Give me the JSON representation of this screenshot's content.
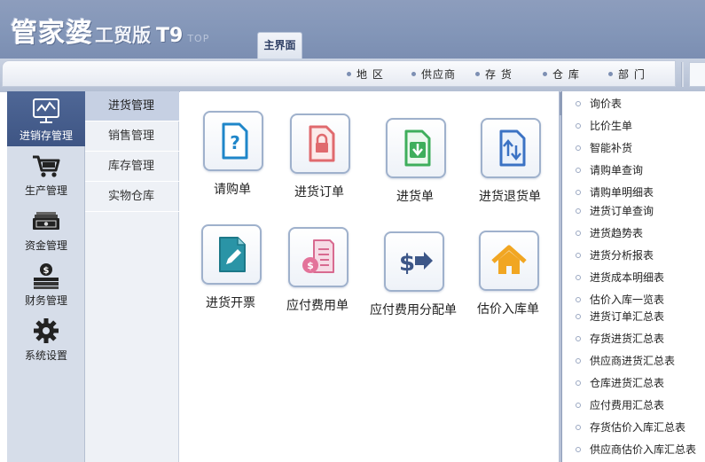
{
  "header": {
    "brand_main": "管家婆",
    "brand_sub": "工贸版",
    "brand_version": "T9",
    "brand_tag": "TOP",
    "main_tab": "主界面"
  },
  "topnav": {
    "items": [
      {
        "label": "地 区",
        "icon": "dot-bullet"
      },
      {
        "label": "供应商",
        "icon": "dot-bullet"
      },
      {
        "label": "存 货",
        "icon": "dot-bullet"
      },
      {
        "label": "仓 库",
        "icon": "dot-bullet"
      },
      {
        "label": "部 门",
        "icon": "dot-bullet"
      }
    ]
  },
  "sidebar": {
    "modules": [
      {
        "label": "进销存管理",
        "icon": "monitor-chart-icon",
        "active": true
      },
      {
        "label": "生产管理",
        "icon": "cart-icon",
        "active": false
      },
      {
        "label": "资金管理",
        "icon": "money-icon",
        "active": false
      },
      {
        "label": "财务管理",
        "icon": "coins-icon",
        "active": false
      },
      {
        "label": "系统设置",
        "icon": "gear-icon",
        "active": false
      }
    ]
  },
  "submenu": {
    "items": [
      {
        "label": "进货管理",
        "active": true
      },
      {
        "label": "销售管理",
        "active": false
      },
      {
        "label": "库存管理",
        "active": false
      },
      {
        "label": "实物仓库",
        "active": false
      }
    ]
  },
  "tiles": [
    {
      "label": "请购单",
      "icon": "question-document-icon"
    },
    {
      "label": "进货订单",
      "icon": "lock-document-icon"
    },
    {
      "label": "进货单",
      "icon": "download-document-icon"
    },
    {
      "label": "进货退货单",
      "icon": "return-document-icon"
    },
    {
      "label": "进货开票",
      "icon": "pencil-document-icon"
    },
    {
      "label": "应付费用单",
      "icon": "coin-document-icon"
    },
    {
      "label": "应付费用分配单",
      "icon": "dollar-arrow-icon"
    },
    {
      "label": "估价入库单",
      "icon": "house-icon"
    }
  ],
  "reports": {
    "items": [
      "询价表",
      "比价生单",
      "智能补货",
      "请购单查询",
      "请购单明细表",
      "进货订单查询",
      "进货趋势表",
      "进货分析报表",
      "进货成本明细表",
      "估价入库一览表",
      "进货订单汇总表",
      "存货进货汇总表",
      "供应商进货汇总表",
      "仓库进货汇总表",
      "应付费用汇总表",
      "存货估价入库汇总表",
      "供应商估价入库汇总表"
    ]
  },
  "colors": {
    "header_bg": "#8396b8",
    "active_module_bg": "#4a6291",
    "active_submenu_bg": "#c6d0e3",
    "tile_border": "#9fb1cc"
  }
}
